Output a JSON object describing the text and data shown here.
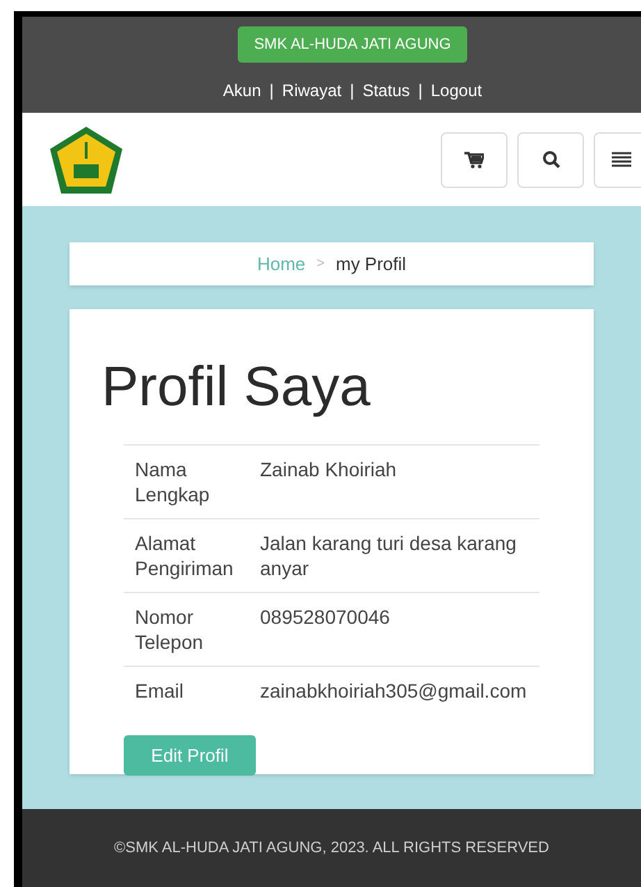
{
  "header": {
    "school_button": "SMK AL-HUDA JATI AGUNG",
    "links": [
      "Akun",
      "Riwayat",
      "Status",
      "Logout"
    ],
    "separator": "|"
  },
  "breadcrumb": {
    "home": "Home",
    "divider": ">",
    "current": "my Profil"
  },
  "profile": {
    "title": "Profil Saya",
    "rows": [
      {
        "label": "Nama Lengkap",
        "value": "Zainab Khoiriah"
      },
      {
        "label": "Alamat Pengiriman",
        "value": "Jalan karang turi desa karang anyar"
      },
      {
        "label": "Nomor Telepon",
        "value": "089528070046"
      },
      {
        "label": "Email",
        "value": "zainabkhoiriah305@gmail.com"
      }
    ],
    "edit_button": "Edit Profil"
  },
  "footer": "©SMK AL-HUDA JATI AGUNG, 2023. ALL RIGHTS RESERVED"
}
